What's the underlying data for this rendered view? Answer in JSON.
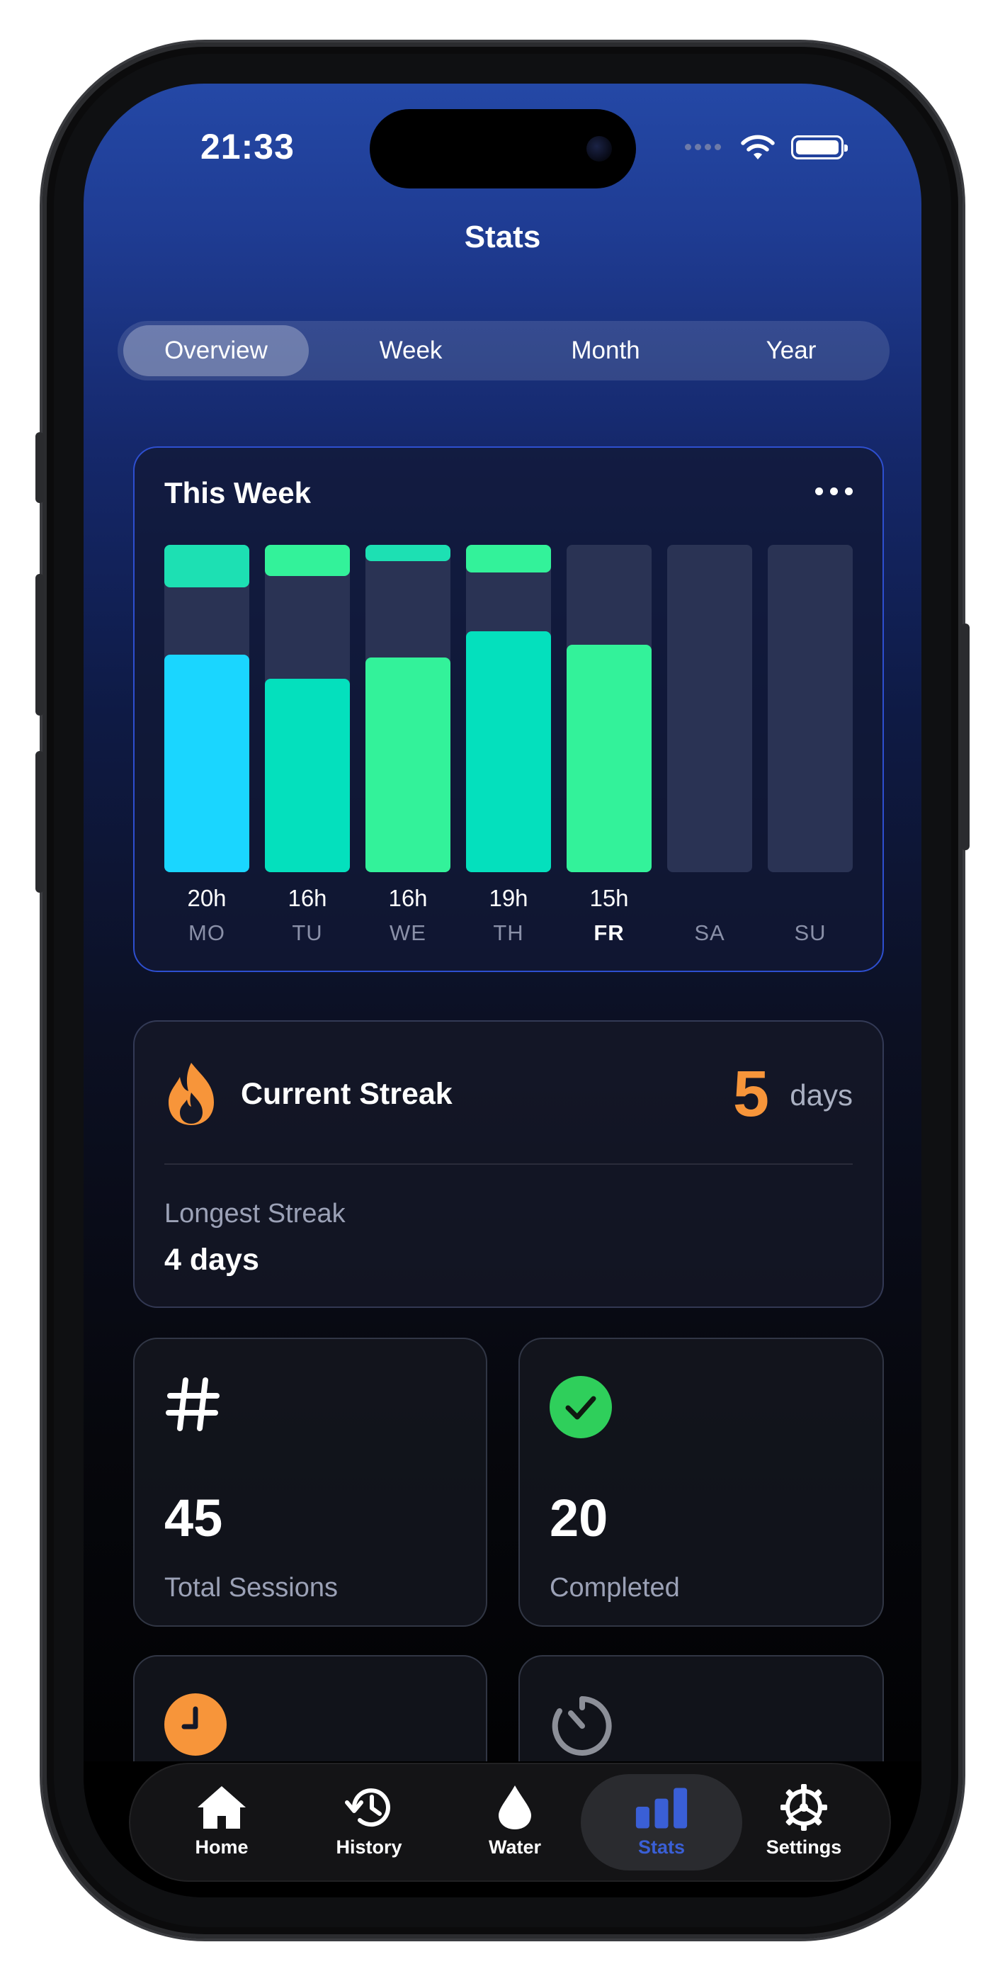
{
  "status_bar": {
    "time": "21:33"
  },
  "header": {
    "title": "Stats"
  },
  "segments": [
    {
      "label": "Overview",
      "active": true
    },
    {
      "label": "Week",
      "active": false
    },
    {
      "label": "Month",
      "active": false
    },
    {
      "label": "Year",
      "active": false
    }
  ],
  "week_card": {
    "title": "This Week",
    "more_icon": "ellipsis-icon",
    "chart_data": {
      "type": "bar",
      "categories": [
        "MO",
        "TU",
        "WE",
        "TH",
        "FR",
        "SA",
        "SU"
      ],
      "today": "FR",
      "hour_labels": [
        "20h",
        "16h",
        "16h",
        "19h",
        "15h",
        "",
        ""
      ],
      "top_segment_fraction": [
        0.13,
        0.095,
        0.05,
        0.085,
        0,
        0,
        0
      ],
      "bottom_segment_fraction": [
        0.665,
        0.59,
        0.655,
        0.735,
        0.695,
        0,
        0
      ],
      "top_colors": [
        "#1de0b3",
        "#33f29a",
        "#1de0b3",
        "#33f29a",
        "",
        "",
        ""
      ],
      "bottom_colors": [
        "#1ad6ff",
        "#04e0bd",
        "#33f29a",
        "#04e0bd",
        "#33f29a",
        "",
        ""
      ],
      "track_color": "#2a3354"
    }
  },
  "streak": {
    "icon": "flame-icon",
    "label": "Current Streak",
    "value": "5",
    "unit": "days",
    "longest_label": "Longest Streak",
    "longest_value": "4 days",
    "accent": "#f7953a"
  },
  "stats": [
    {
      "icon": "hash-icon",
      "value": "45",
      "label": "Total Sessions"
    },
    {
      "icon": "check-circle-icon",
      "value": "20",
      "label": "Completed",
      "color": "#2fcf5b"
    },
    {
      "icon": "clock-icon",
      "value": "",
      "label": "",
      "color": "#f7953a"
    },
    {
      "icon": "timer-icon",
      "value": "",
      "label": ""
    }
  ],
  "tabbar": [
    {
      "icon": "home-icon",
      "label": "Home",
      "active": false
    },
    {
      "icon": "history-icon",
      "label": "History",
      "active": false
    },
    {
      "icon": "water-drop-icon",
      "label": "Water",
      "active": false
    },
    {
      "icon": "bar-chart-icon",
      "label": "Stats",
      "active": true,
      "color": "#3a5fd6"
    },
    {
      "icon": "gear-icon",
      "label": "Settings",
      "active": false
    }
  ]
}
